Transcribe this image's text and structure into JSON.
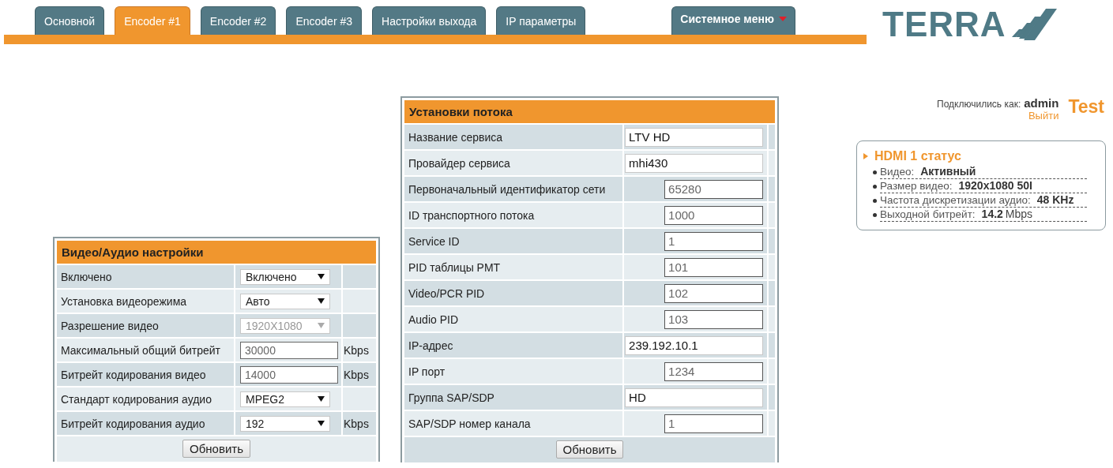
{
  "tabs": [
    {
      "label": "Основной",
      "selected": false
    },
    {
      "label": "Encoder #1",
      "selected": true
    },
    {
      "label": "Encoder #2",
      "selected": false
    },
    {
      "label": "Encoder #3",
      "selected": false
    },
    {
      "label": "Настройки выхода",
      "selected": false
    },
    {
      "label": "IP параметры",
      "selected": false
    }
  ],
  "system_menu": {
    "label": "Системное меню"
  },
  "logo": {
    "text": "TERRA"
  },
  "session": {
    "prefix": "Подключились как:",
    "user": "admin",
    "logout": "Выйти",
    "device_name": "Test"
  },
  "av_settings": {
    "title": "Видео/Аудио настройки",
    "rows": [
      {
        "label": "Включено",
        "kind": "select",
        "value": "Включено",
        "disabled": false
      },
      {
        "label": "Установка видеорежима",
        "kind": "select",
        "value": "Авто",
        "disabled": false
      },
      {
        "label": "Разрешение видео",
        "kind": "select",
        "value": "1920X1080",
        "disabled": true
      },
      {
        "label": "Максимальный общий битрейт",
        "kind": "input",
        "value": "30000",
        "unit": "Kbps",
        "disabled": false
      },
      {
        "label": "Битрейт кодирования видео",
        "kind": "input",
        "value": "14000",
        "unit": "Kbps",
        "disabled": false
      },
      {
        "label": "Стандарт кодирования аудио",
        "kind": "select",
        "value": "MPEG2",
        "disabled": false
      },
      {
        "label": "Битрейт кодирования аудио",
        "kind": "select",
        "value": "192",
        "unit": "Kbps",
        "disabled": false
      }
    ],
    "button": "Обновить"
  },
  "stream_settings": {
    "title": "Установки потока",
    "rows": [
      {
        "label": "Название сервиса",
        "kind": "wide",
        "value": "LTV HD"
      },
      {
        "label": "Провайдер сервиса",
        "kind": "wide",
        "value": "mhi430"
      },
      {
        "label": "Первоначальный идентификатор сети",
        "kind": "narrow",
        "value": "65280"
      },
      {
        "label": "ID транспортного потока",
        "kind": "narrow",
        "value": "1000"
      },
      {
        "label": "Service ID",
        "kind": "narrow",
        "value": "1"
      },
      {
        "label": "PID таблицы PMT",
        "kind": "narrow",
        "value": "101"
      },
      {
        "label": "Video/PCR PID",
        "kind": "narrow",
        "value": "102"
      },
      {
        "label": "Audio PID",
        "kind": "narrow",
        "value": "103"
      },
      {
        "label": "IP-адрес",
        "kind": "wide",
        "value": "239.192.10.1"
      },
      {
        "label": "IP порт",
        "kind": "narrow",
        "value": "1234"
      },
      {
        "label": "Группа SAP/SDP",
        "kind": "wide",
        "value": "HD"
      },
      {
        "label": "SAP/SDP номер канала",
        "kind": "narrow",
        "value": "1"
      }
    ],
    "button": "Обновить"
  },
  "hdmi_status": {
    "title": "HDMI 1 статус",
    "items": [
      {
        "label": "Видео:",
        "value": "Активный"
      },
      {
        "label": "Размер видео:",
        "value": "1920x1080 50I"
      },
      {
        "label": "Частота дискретизации аудио:",
        "value": "48 KHz"
      },
      {
        "label": "Выходной битрейт:",
        "value": "14.2",
        "unit": "Mbps"
      }
    ]
  }
}
